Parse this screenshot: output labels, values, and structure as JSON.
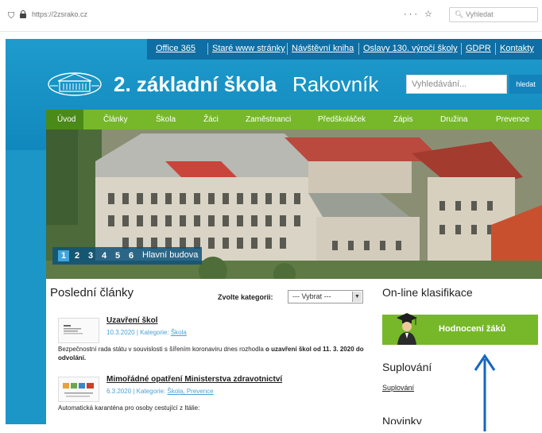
{
  "browser": {
    "url": "https://2zsrako.cz",
    "tools": "··· ☆",
    "search_placeholder": "Vyhledat"
  },
  "toplinks": [
    "Office 365",
    "Staré www stránky",
    "Návštěvní kniha",
    "Oslavy 130. výročí školy",
    "GDPR",
    "Kontakty"
  ],
  "header": {
    "title_bold": "2. základní škola",
    "title_light": "Rakovník",
    "search_placeholder": "Vyhledávání...",
    "search_button": "hledat"
  },
  "nav": [
    "Úvod",
    "Články",
    "Škola",
    "Žáci",
    "Zaměstnanci",
    "Předškoláček",
    "Zápis",
    "Družina",
    "Prevence"
  ],
  "slider": {
    "numbers": [
      "1",
      "2",
      "3",
      "4",
      "5",
      "6"
    ],
    "active": "1",
    "caption": "Hlavní budova"
  },
  "articles_section": {
    "heading": "Poslední články",
    "category_label": "Zvolte kategorii:",
    "category_value": "--- Vybrat ---"
  },
  "articles": [
    {
      "title": "Uzavření škol",
      "date": "10.3.2020",
      "category_label": "Kategorie:",
      "categories": "Škola",
      "excerpt_start": "Bezpečnostní rada státu v souvislosti s šířením koronaviru dnes rozhodla ",
      "excerpt_bold": "o uzavření škol od 11. 3. 2020 do odvolání."
    },
    {
      "title": "Mimořádné opatření Ministerstva zdravotnictví",
      "date": "6.3.2020",
      "category_label": "Kategorie:",
      "categories": "Škola, Prevence",
      "excerpt_start": "Automatická karanténa pro osoby cestující z Itálie:",
      "excerpt_bold": ""
    }
  ],
  "sidebar": {
    "online_heading": "On-line klasifikace",
    "grade_button": "Hodnocení žáků",
    "substitutions_heading": "Suplování",
    "substitutions_link": "Suplování",
    "news_heading": "Novinky"
  },
  "colors": {
    "site_blue": "#1c96c7",
    "nav_green": "#76b82a",
    "active_green": "#4a8a19",
    "annotation_arrow": "#1565c0"
  }
}
